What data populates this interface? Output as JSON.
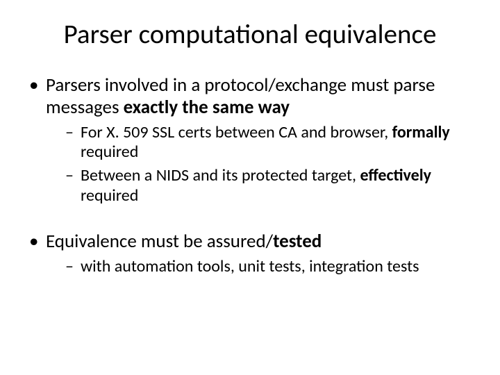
{
  "title": "Parser computational equivalence",
  "b1": {
    "pre": "Parsers involved in a protocol/exchange must parse messages ",
    "bold": "exactly the same way"
  },
  "b1s1": {
    "pre": "For X. 509 SSL certs between CA and browser, ",
    "bold": "formally",
    "post": " required"
  },
  "b1s2": {
    "pre": "Between a NIDS and its protected target, ",
    "bold": "effectively",
    "post": " required"
  },
  "b2": {
    "pre": "Equivalence must be assured/",
    "bold": "tested"
  },
  "b2s1": "with automation tools, unit tests, integration tests"
}
